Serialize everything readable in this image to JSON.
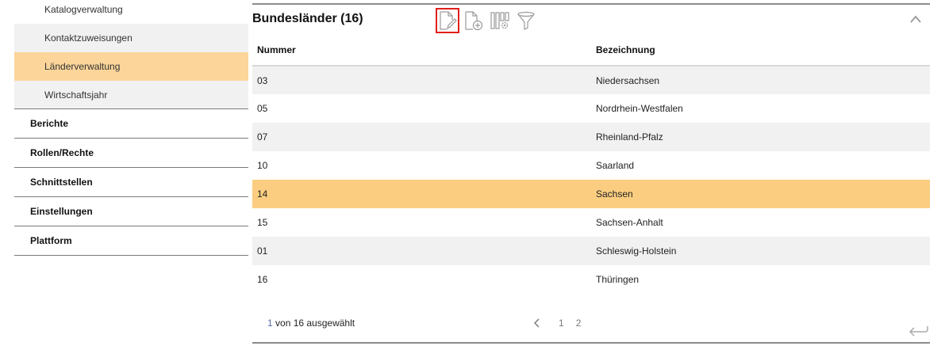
{
  "sidebar": {
    "sub_items": [
      {
        "label": "Katalogverwaltung"
      },
      {
        "label": "Kontaktzuweisungen"
      },
      {
        "label": "Länderverwaltung"
      },
      {
        "label": "Wirtschaftsjahr"
      }
    ],
    "main_items": [
      {
        "label": "Berichte"
      },
      {
        "label": "Rollen/Rechte"
      },
      {
        "label": "Schnittstellen"
      },
      {
        "label": "Einstellungen"
      },
      {
        "label": "Plattform"
      }
    ]
  },
  "panel": {
    "title": "Bundesländer (16)",
    "toolbar": [
      "edit-document-icon",
      "new-document-icon",
      "column-settings-icon",
      "filter-icon"
    ],
    "columns": [
      "Nummer",
      "Bezeichnung"
    ],
    "rows": [
      {
        "nummer": "03",
        "bezeichnung": "Niedersachsen"
      },
      {
        "nummer": "05",
        "bezeichnung": "Nordrhein-Westfalen"
      },
      {
        "nummer": "07",
        "bezeichnung": "Rheinland-Pfalz"
      },
      {
        "nummer": "10",
        "bezeichnung": "Saarland"
      },
      {
        "nummer": "14",
        "bezeichnung": "Sachsen"
      },
      {
        "nummer": "15",
        "bezeichnung": "Sachsen-Anhalt"
      },
      {
        "nummer": "01",
        "bezeichnung": "Schleswig-Holstein"
      },
      {
        "nummer": "16",
        "bezeichnung": "Thüringen"
      }
    ],
    "selected_row": 4,
    "footer": {
      "selected_count": "1",
      "selected_text": " von 16 ausgewählt",
      "pages": [
        "1",
        "2"
      ]
    }
  },
  "colors": {
    "active_nav": "#fbd599",
    "selected_row": "#fbcd80",
    "toolbar_highlight": "#e0201c"
  }
}
